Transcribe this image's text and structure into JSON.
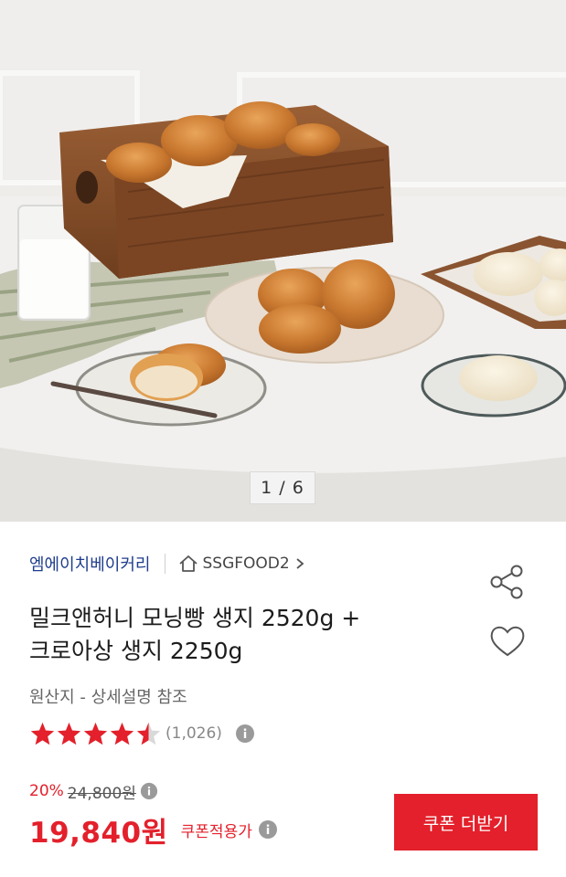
{
  "gallery": {
    "image_alt": "bread-rolls-photo",
    "counter": "1 / 6"
  },
  "seller": {
    "name": "엠에이치베이커리",
    "store_label": "SSGFOOD2"
  },
  "product": {
    "title_line1": "밀크앤허니 모닝빵 생지 2520g +",
    "title_line2": "크로아상 생지 2250g",
    "origin": "원산지 - 상세설명 참조"
  },
  "rating": {
    "value": 4.5,
    "max": 5,
    "review_count": "(1,026)"
  },
  "price": {
    "discount": "20%",
    "original": "24,800원",
    "final": "19,840원",
    "final_label": "쿠폰적용가"
  },
  "actions": {
    "coupon_button": "쿠폰 더받기"
  },
  "colors": {
    "accent": "#e3202b",
    "seller": "#1f3d8c"
  },
  "icons": {
    "home": "home-icon",
    "chevron": "chevron-right-icon",
    "share": "share-icon",
    "like": "heart-icon",
    "info": "info-icon",
    "star": "star-icon"
  }
}
